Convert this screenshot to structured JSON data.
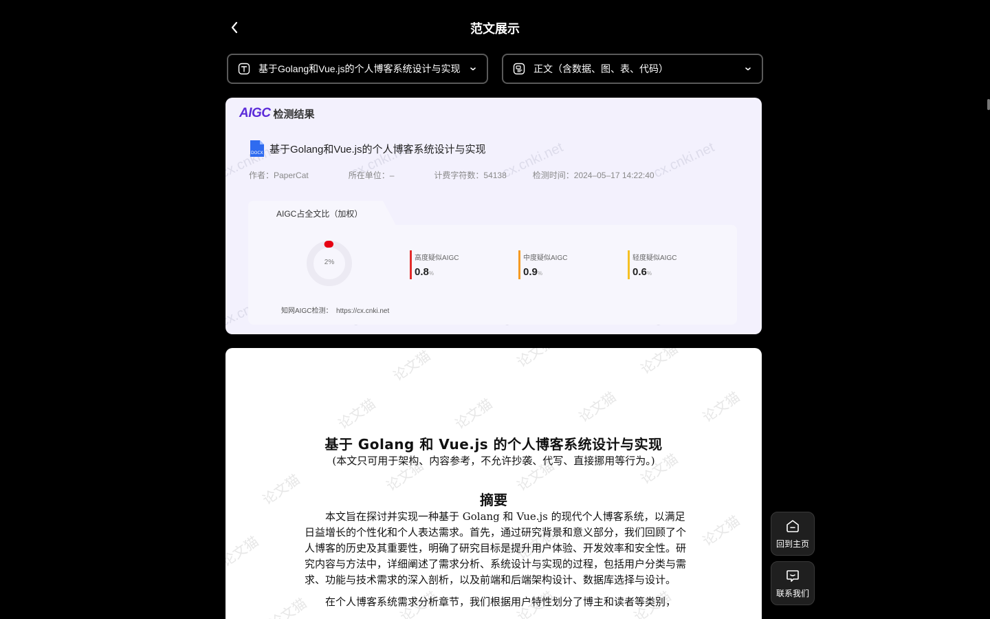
{
  "header": {
    "title": "范文展示"
  },
  "selects": {
    "document": "基于Golang和Vue.js的个人博客系统设计与实现",
    "section": "正文（含数据、图、表、代码）"
  },
  "report": {
    "logo": "AIGC",
    "heading": "检测结果",
    "doc_title": "基于Golang和Vue.js的个人博客系统设计与实现",
    "author": "作者：PaperCat",
    "unit": "所在单位：–",
    "chars": "计费字符数：54138",
    "time": "检测时间：2024–05–17 14:22:40",
    "tab": "AIGC占全文比（加权）",
    "overall_percent": "2%",
    "overall_value": 2,
    "stats": [
      {
        "label": "高度疑似AIGC",
        "value": "0.8",
        "unit": "%",
        "color": "#e22b2b"
      },
      {
        "label": "中度疑似AIGC",
        "value": "0.9",
        "unit": "%",
        "color": "#f59a23"
      },
      {
        "label": "轻度疑似AIGC",
        "value": "0.6",
        "unit": "%",
        "color": "#f5c023"
      }
    ],
    "footer_label": "知网AIGC检测：",
    "footer_url": "https://cx.cnki.net",
    "watermark": "cx.cnki.net",
    "accent": "#5b2bd9",
    "donut_color": "#e60012"
  },
  "paper": {
    "title": "基于 Golang 和 Vue.js 的个人博客系统设计与实现",
    "note": "(本文只可用于架构、内容参考，不允许抄袭、代写、直接挪用等行为。)",
    "abstract_heading": "摘要",
    "para1": "本文旨在探讨并实现一种基于 Golang 和 Vue.js 的现代个人博客系统，以满足日益增长的个性化和个人表达需求。首先，通过研究背景和意义部分，我们回顾了个人博客的历史及其重要性，明确了研究目标是提升用户体验、开发效率和安全性。研究内容与方法中，详细阐述了需求分析、系统设计与实现的过程，包括用户分类与需求、功能与技术需求的深入剖析，以及前端和后端架构设计、数据库选择与设计。",
    "para2": "在个人博客系统需求分析章节，我们根据用户特性划分了博主和读者等类别，",
    "watermark": "论文猫"
  },
  "fabs": {
    "home": "回到主页",
    "contact": "联系我们"
  }
}
